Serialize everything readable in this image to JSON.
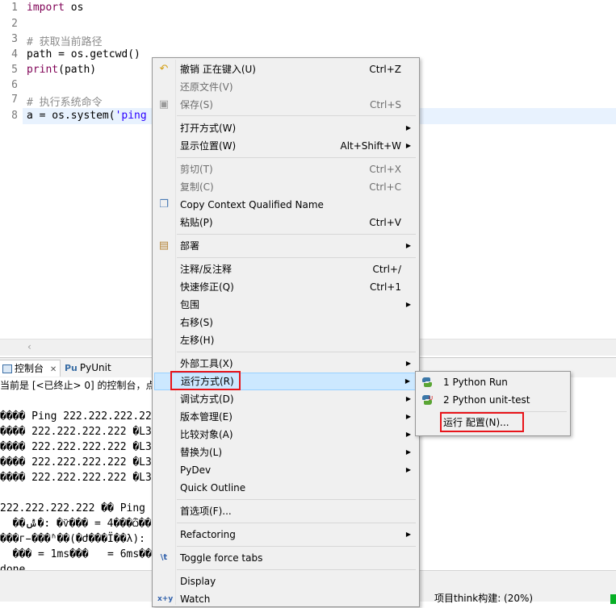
{
  "editor": {
    "line_numbers": [
      "1",
      "2",
      "3",
      "4",
      "5",
      "6",
      "7",
      "8"
    ],
    "lines": {
      "l1_kw": "import",
      "l1_rest": " os",
      "l3": "# 获取当前路径",
      "l4": "path = os.getcwd()",
      "l5_kw": "print",
      "l5_rest": "(path)",
      "l7": "# 执行系统命令",
      "l8_a": "a = os.system(",
      "l8_str": "'ping"
    }
  },
  "console": {
    "tab_console": "控制台",
    "tab_close": "✕",
    "tab_pyunit": "PyUnit",
    "header": "当前是 [<已终止> 0] 的控制台，点击",
    "lines": [
      "���� Ping 222.222.222.222",
      "���� 222.222.222.222 �L32",
      "���� 222.222.222.222 �L32",
      "���� 222.222.222.222 �L32",
      "���� 222.222.222.222 �L32",
      "",
      "222.222.222.222 �� Ping ͳ�",
      "  ��ݰ�: �ѷ��� = 4���ѽ��",
      "���г̵���ʱ��(�Ժ���Ϊ��λ):",
      "  ��� = 1ms���   = 6ms��",
      "done"
    ]
  },
  "status": {
    "build": "项目think构建: (20%)"
  },
  "menu": {
    "items": [
      {
        "label": "撤销 正在键入(U)",
        "accel": "Ctrl+Z",
        "icon": "undo-icon"
      },
      {
        "label": "还原文件(V)",
        "accel": ""
      },
      {
        "label": "保存(S)",
        "accel": "Ctrl+S",
        "icon": "save-icon"
      },
      {
        "label": "打开方式(W)",
        "accel": ""
      },
      {
        "label": "显示位置(W)",
        "accel": "Alt+Shift+W"
      },
      {
        "label": "剪切(T)",
        "accel": "Ctrl+X"
      },
      {
        "label": "复制(C)",
        "accel": "Ctrl+C"
      },
      {
        "label": "Copy Context Qualified Name",
        "accel": "",
        "icon": "copy-context-icon"
      },
      {
        "label": "粘贴(P)",
        "accel": "Ctrl+V"
      },
      {
        "label": "部署",
        "accel": "",
        "icon": "deploy-icon"
      },
      {
        "label": "注释/反注释",
        "accel": "Ctrl+/"
      },
      {
        "label": "快速修正(Q)",
        "accel": "Ctrl+1"
      },
      {
        "label": "包围",
        "accel": ""
      },
      {
        "label": "右移(S)",
        "accel": ""
      },
      {
        "label": "左移(H)",
        "accel": ""
      },
      {
        "label": "外部工具(X)",
        "accel": ""
      },
      {
        "label": "运行方式(R)",
        "accel": ""
      },
      {
        "label": "调试方式(D)",
        "accel": ""
      },
      {
        "label": "版本管理(E)",
        "accel": ""
      },
      {
        "label": "比较对象(A)",
        "accel": ""
      },
      {
        "label": "替换为(L)",
        "accel": ""
      },
      {
        "label": "PyDev",
        "accel": ""
      },
      {
        "label": "Quick Outline",
        "accel": ""
      },
      {
        "label": "首选项(F)...",
        "accel": ""
      },
      {
        "label": "Refactoring",
        "accel": ""
      },
      {
        "label": "Toggle force tabs",
        "accel": "",
        "icon": "toggle-tabs-icon"
      },
      {
        "label": "Display",
        "accel": ""
      },
      {
        "label": "Watch",
        "accel": ""
      }
    ],
    "toggle_icon_text": "\\t",
    "watch_icon_text": "x+y"
  },
  "submenu": {
    "items": [
      {
        "label": "1 Python Run",
        "icon": "python-run-icon"
      },
      {
        "label": "2 Python unit-test",
        "icon": "python-unittest-icon"
      },
      {
        "label": "运行 配置(N)..."
      }
    ]
  },
  "colors": {
    "highlight_box": "#e8141a",
    "menu_hover": "#cce8ff",
    "progress": "#06b025"
  }
}
